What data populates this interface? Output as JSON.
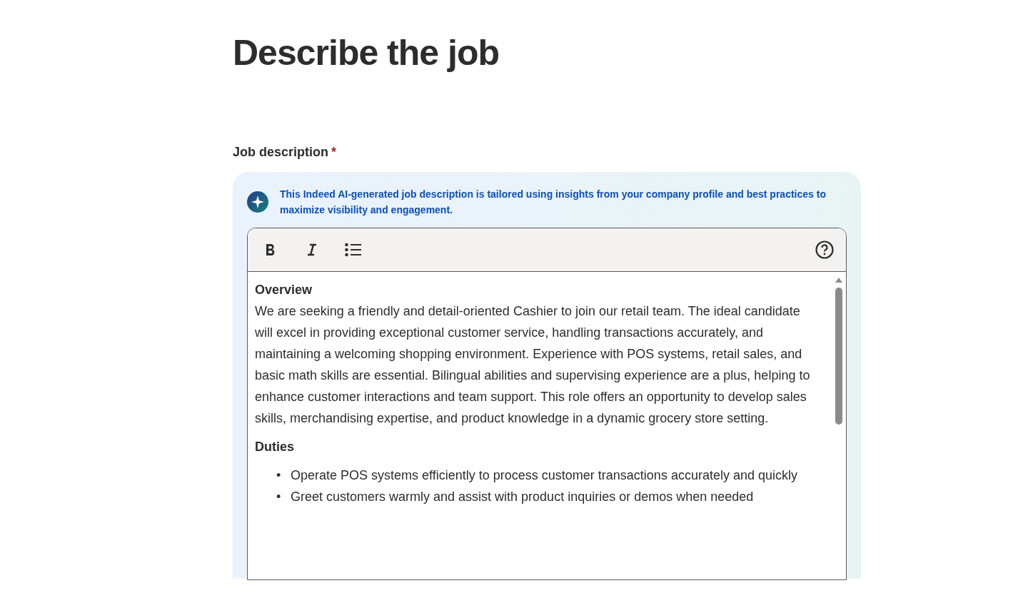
{
  "page_title": "Describe the job",
  "field": {
    "label": "Job description",
    "required": true,
    "required_mark": "*"
  },
  "ai_notice": "This Indeed AI-generated job description is tailored using insights from your company profile and best practices to maximize visibility and engagement.",
  "toolbar": [
    {
      "kind": "bold"
    },
    {
      "kind": "italic"
    },
    {
      "kind": "list"
    },
    {
      "kind": "help"
    }
  ],
  "content": [
    {
      "kind": "heading",
      "text": "Overview"
    },
    {
      "kind": "paragraph",
      "text": "We are seeking a friendly and detail-oriented Cashier to join our retail team. The ideal candidate will excel in providing exceptional customer service, handling transactions accurately, and maintaining a welcoming shopping environment. Experience with POS systems, retail sales, and basic math skills are essential. Bilingual abilities and supervising experience are a plus, helping to enhance customer interactions and team support. This role offers an opportunity to develop sales skills, merchandising expertise, and product knowledge in a dynamic grocery store setting."
    },
    {
      "kind": "heading",
      "text": "Duties"
    },
    {
      "kind": "bullets",
      "marker": "•",
      "items": [
        "Operate POS systems efficiently to process customer transactions accurately and quickly",
        "Greet customers warmly and assist with product inquiries or demos when needed"
      ]
    }
  ]
}
